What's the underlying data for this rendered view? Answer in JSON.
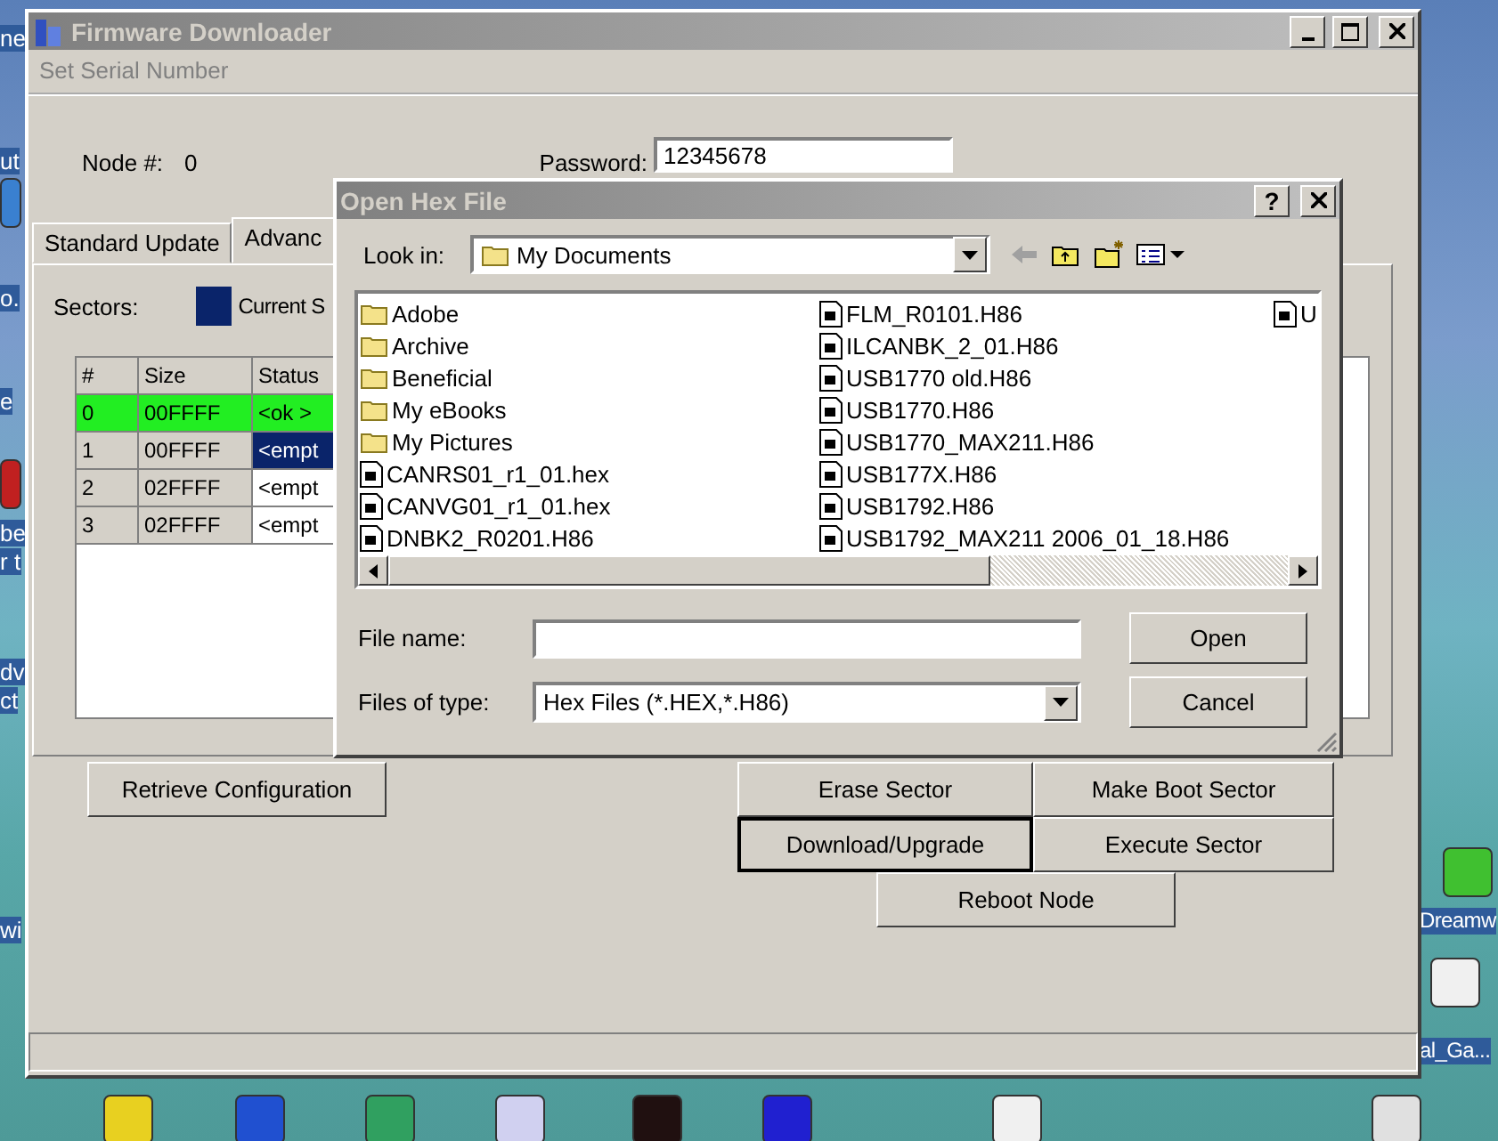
{
  "desktop": {
    "left_labels": [
      "ne",
      "ut",
      "o.",
      "e",
      "be",
      "r t",
      "dv",
      "ct",
      "wi"
    ],
    "right_icons": [
      {
        "label": "Dreamw"
      },
      {
        "label": "al_Ga..."
      }
    ]
  },
  "main_window": {
    "title": "Firmware Downloader",
    "menu": [
      {
        "label": "Set Serial Number",
        "disabled": true
      }
    ],
    "node_label": "Node #:",
    "node_value": "0",
    "password_label": "Password:",
    "password_value": "12345678",
    "tabs": [
      {
        "label": "Standard Update",
        "selected": false
      },
      {
        "label": "Advanc",
        "selected": true
      }
    ],
    "sectors_label": "Sectors:",
    "legend": {
      "label": "Current S",
      "color": "#0a246a"
    },
    "table": {
      "columns": [
        "#",
        "Size",
        "Status"
      ],
      "rows": [
        {
          "cells": [
            "0",
            "00FFFF",
            "<ok >"
          ],
          "kind": "ok",
          "selected": false
        },
        {
          "cells": [
            "1",
            "00FFFF",
            "<empt"
          ],
          "kind": "empty",
          "selected": true
        },
        {
          "cells": [
            "2",
            "02FFFF",
            "<empt"
          ],
          "kind": "empty",
          "selected": false
        },
        {
          "cells": [
            "3",
            "02FFFF",
            "<empt"
          ],
          "kind": "empty",
          "selected": false
        }
      ]
    },
    "retrieve_button": {
      "label": "Retrieve Configuration",
      "focused": false
    },
    "action_buttons": [
      {
        "label": "Erase Sector",
        "focused": false
      },
      {
        "label": "Make Boot Sector",
        "focused": false
      },
      {
        "label": "Download/Upgrade",
        "focused": true
      },
      {
        "label": "Execute Sector",
        "focused": false
      }
    ],
    "reboot_button": {
      "label": "Reboot Node",
      "focused": false
    }
  },
  "dialog": {
    "title": "Open Hex File",
    "look_in_label": "Look in:",
    "look_in_value": "My Documents",
    "files": [
      [
        {
          "name": "Adobe",
          "kind": "folder"
        },
        {
          "name": "Archive",
          "kind": "folder"
        },
        {
          "name": "Beneficial",
          "kind": "folder"
        },
        {
          "name": "My eBooks",
          "kind": "folder"
        },
        {
          "name": "My Pictures",
          "kind": "folder"
        },
        {
          "name": "CANRS01_r1_01.hex",
          "kind": "file"
        },
        {
          "name": "CANVG01_r1_01.hex",
          "kind": "file"
        },
        {
          "name": "DNBK2_R0201.H86",
          "kind": "file"
        }
      ],
      [
        {
          "name": "FLM_R0101.H86",
          "kind": "file"
        },
        {
          "name": "ILCANBK_2_01.H86",
          "kind": "file"
        },
        {
          "name": "USB1770 old.H86",
          "kind": "file"
        },
        {
          "name": "USB1770.H86",
          "kind": "file"
        },
        {
          "name": "USB1770_MAX211.H86",
          "kind": "file"
        },
        {
          "name": "USB177X.H86",
          "kind": "file"
        },
        {
          "name": "USB1792.H86",
          "kind": "file"
        },
        {
          "name": "USB1792_MAX211 2006_01_18.H86",
          "kind": "file"
        }
      ],
      [
        {
          "name": "U",
          "kind": "file"
        }
      ]
    ],
    "help_label": "?",
    "file_name_label": "File name:",
    "file_type_label": "Files of type:",
    "file_type_value": "Hex Files  (*.HEX,*.H86)",
    "buttons": [
      {
        "label": "Open",
        "focused": false
      },
      {
        "label": "Cancel",
        "focused": false
      }
    ]
  }
}
